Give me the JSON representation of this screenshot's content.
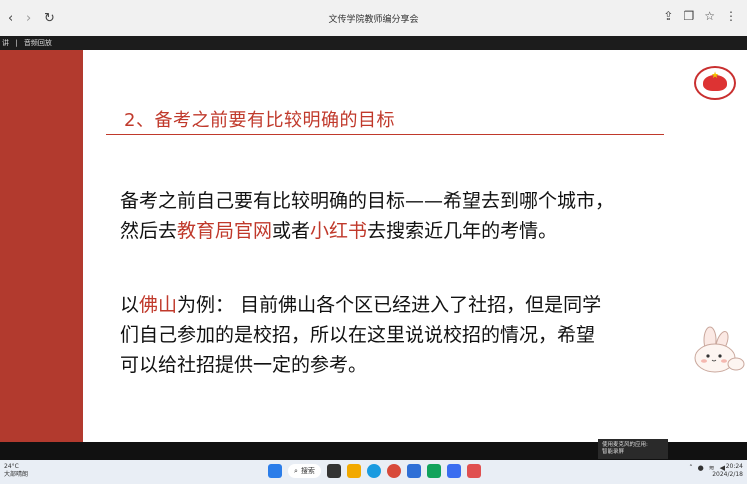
{
  "browser": {
    "title": "文传学院教师编分享会",
    "back": "‹",
    "forward": "›",
    "reload": "↻"
  },
  "meeting_strip": {
    "items": [
      "讲",
      "|",
      "音频回放"
    ]
  },
  "slide": {
    "heading": "2、备考之前要有比较明确的目标",
    "para1": [
      [
        {
          "t": "备考之前自己要有比较明确的目标——希望去到哪个城市，",
          "h": false
        }
      ],
      [
        {
          "t": "然后去",
          "h": false
        },
        {
          "t": "教育局官网",
          "h": true
        },
        {
          "t": "或者",
          "h": false
        },
        {
          "t": "小红书",
          "h": true
        },
        {
          "t": "去搜索近几年的考情。",
          "h": false
        }
      ]
    ],
    "para2": [
      [
        {
          "t": "以",
          "h": false
        },
        {
          "t": "佛山",
          "h": true
        },
        {
          "t": "为例：  目前佛山各个区已经进入了社招，但是同学",
          "h": false
        }
      ],
      [
        {
          "t": "们自己参加的是校招，所以在这里说说校招的情况，希望",
          "h": false
        }
      ],
      [
        {
          "t": "可以给社招提供一定的参考。",
          "h": false
        }
      ]
    ]
  },
  "toast": {
    "line1": "使用麦克风的应用:",
    "line2": "智能录屏"
  },
  "taskbar": {
    "weather_temp": "24°C",
    "weather_desc": "大部晴朗",
    "search_label": "搜索",
    "time": "20:24",
    "date": "2024/2/18"
  },
  "colors": {
    "accent_red": "#c0392b",
    "side_bar": "#b23a2e"
  }
}
